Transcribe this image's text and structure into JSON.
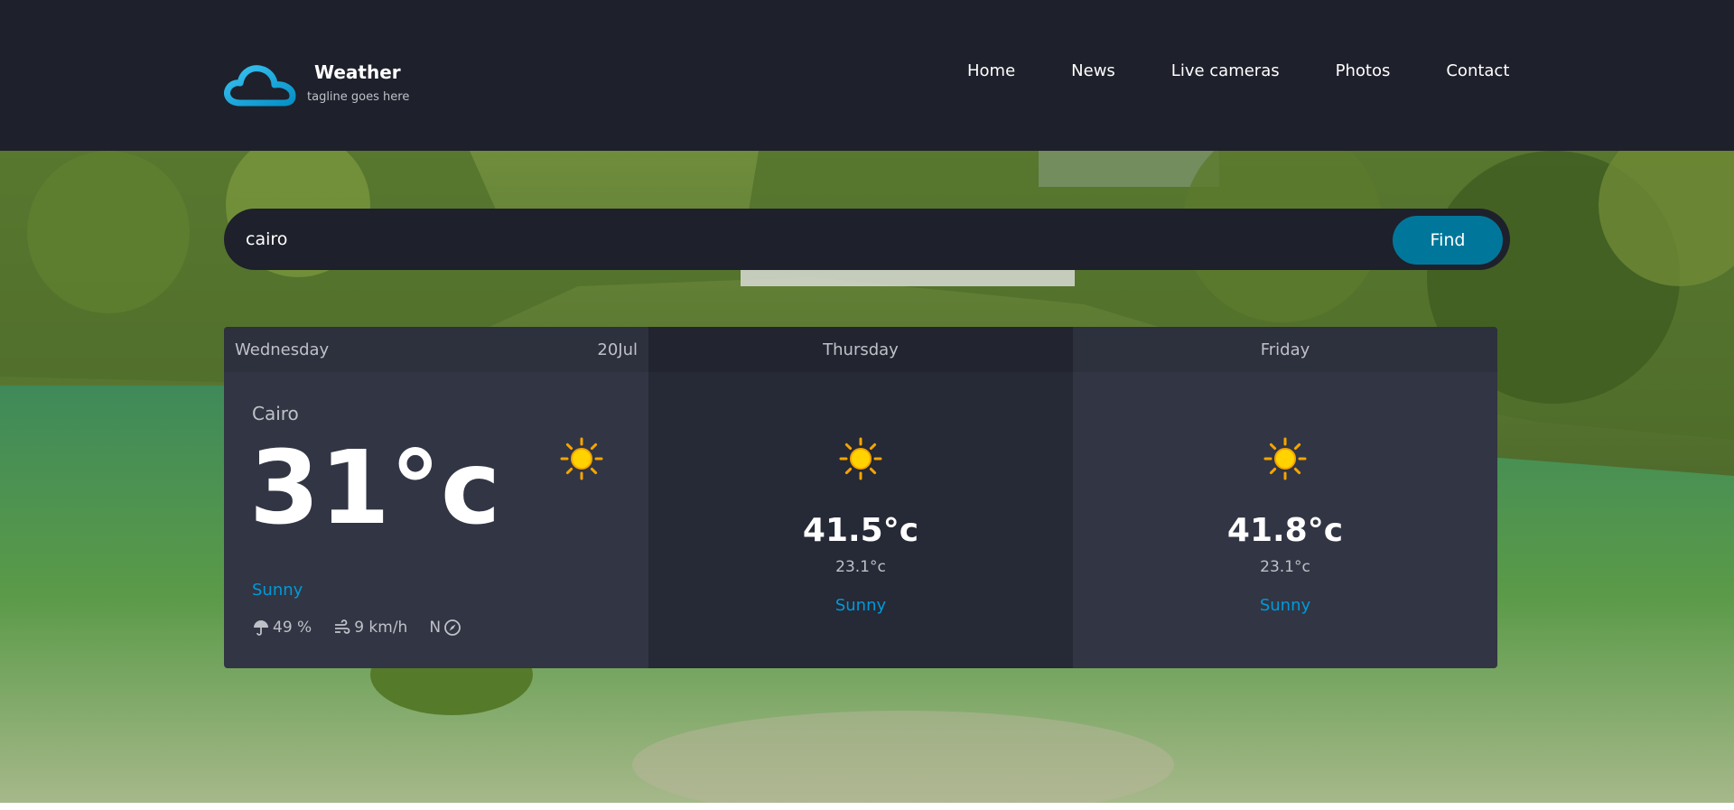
{
  "brand": {
    "name": "Weather",
    "tagline": "tagline goes here"
  },
  "nav": [
    "Home",
    "News",
    "Live cameras",
    "Photos",
    "Contact"
  ],
  "search": {
    "value": "cairo",
    "button_label": "Find"
  },
  "today": {
    "day": "Wednesday",
    "date": "20Jul",
    "location": "Cairo",
    "temperature": "31°c",
    "condition": "Sunny",
    "humidity": "49 %",
    "wind_speed": "9 km/h",
    "wind_direction": "N",
    "icon": "sun-icon"
  },
  "forecast": [
    {
      "day": "Thursday",
      "max_temp": "41.5°c",
      "min_temp": "23.1°c",
      "condition": "Sunny",
      "icon": "sun-icon"
    },
    {
      "day": "Friday",
      "max_temp": "41.8°c",
      "min_temp": "23.1°c",
      "condition": "Sunny",
      "icon": "sun-icon"
    }
  ],
  "colors": {
    "header_bg": "#1e202b",
    "accent": "#009ad8",
    "button": "#00779a",
    "card_light": "#323544",
    "card_dark": "#262936"
  }
}
